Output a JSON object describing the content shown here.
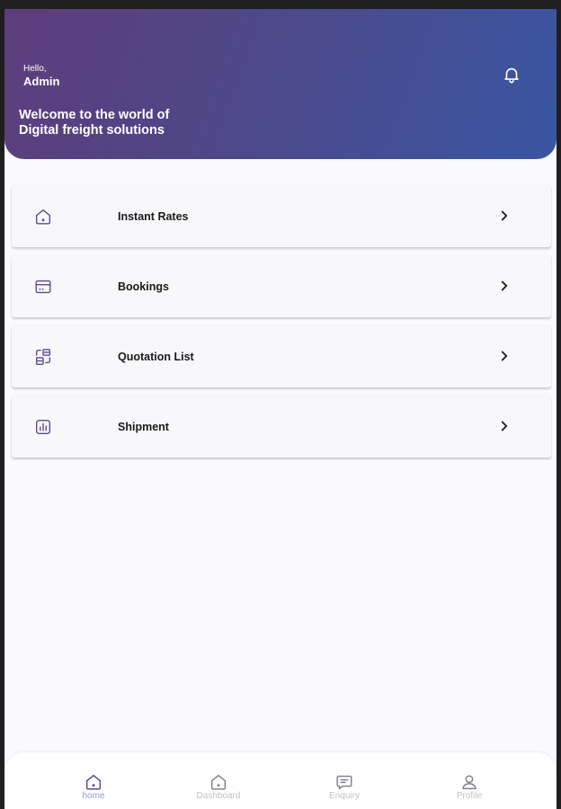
{
  "header": {
    "greeting": "Hello,",
    "user_name": "Admin",
    "welcome_line1": "Welcome to the world of",
    "welcome_line2": "Digital freight solutions",
    "notification_icon": "bell-icon"
  },
  "menu": [
    {
      "label": "Instant Rates",
      "icon": "home-icon"
    },
    {
      "label": "Bookings",
      "icon": "card-icon"
    },
    {
      "label": "Quotation List",
      "icon": "quotation-icon"
    },
    {
      "label": "Shipment",
      "icon": "chart-icon"
    }
  ],
  "bottom_nav": {
    "items": [
      {
        "label": "home",
        "icon": "home-icon",
        "active": true
      },
      {
        "label": "Dashboard",
        "icon": "dashboard-icon",
        "active": false
      },
      {
        "label": "Enquiry",
        "icon": "chat-icon",
        "active": false
      },
      {
        "label": "Profile",
        "icon": "user-icon",
        "active": false
      }
    ]
  },
  "colors": {
    "header_gradient_start": "#5e3d7c",
    "header_gradient_end": "#3a56a3",
    "icon_accent": "#5b4a8a",
    "nav_active": "#8e98d8",
    "nav_inactive": "#c3c3c8"
  }
}
